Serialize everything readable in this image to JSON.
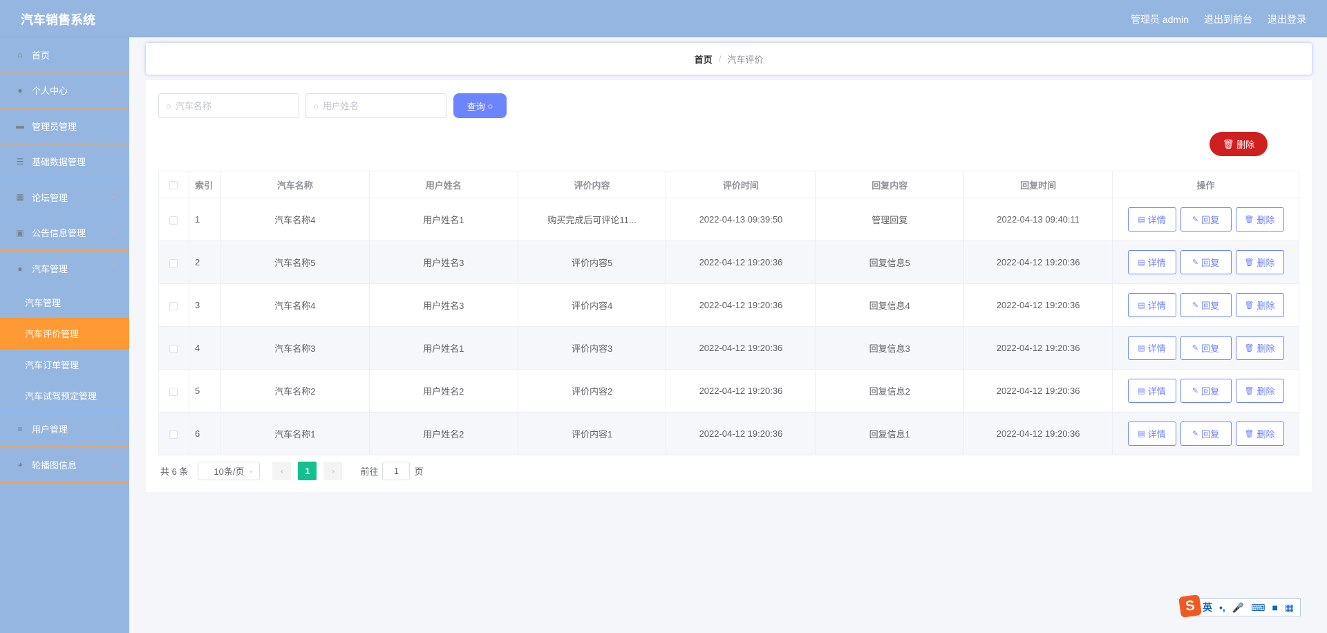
{
  "header": {
    "title": "汽车销售系统",
    "user": "管理员 admin",
    "to_front": "退出到前台",
    "logout": "退出登录"
  },
  "sidebar": {
    "items": [
      {
        "label": "首页",
        "icon": "home-icon"
      },
      {
        "label": "个人中心",
        "icon": "user-icon"
      },
      {
        "label": "管理员管理",
        "icon": "monitor-icon"
      },
      {
        "label": "基础数据管理",
        "icon": "list-icon"
      },
      {
        "label": "论坛管理",
        "icon": "grid-icon"
      },
      {
        "label": "公告信息管理",
        "icon": "clipboard-icon"
      },
      {
        "label": "汽车管理",
        "icon": "user-icon",
        "children": [
          "汽车管理",
          "汽车评价管理",
          "汽车订单管理",
          "汽车试驾预定管理"
        ]
      },
      {
        "label": "用户管理",
        "icon": "sliders-icon"
      },
      {
        "label": "轮播图信息",
        "icon": "gauge-icon"
      }
    ]
  },
  "breadcrumb": {
    "home": "首页",
    "sep": "/",
    "current": "汽车评价"
  },
  "search": {
    "car_placeholder": "汽车名称",
    "user_placeholder": "用户姓名",
    "query": "查询"
  },
  "toolbar": {
    "delete": "删除"
  },
  "table": {
    "headers": [
      "索引",
      "汽车名称",
      "用户姓名",
      "评价内容",
      "评价时间",
      "回复内容",
      "回复时间",
      "操作"
    ],
    "rows": [
      [
        "1",
        "汽车名称4",
        "用户姓名1",
        "购买完成后可评论11...",
        "2022-04-13 09:39:50",
        "管理回复",
        "2022-04-13 09:40:11"
      ],
      [
        "2",
        "汽车名称5",
        "用户姓名3",
        "评价内容5",
        "2022-04-12 19:20:36",
        "回复信息5",
        "2022-04-12 19:20:36"
      ],
      [
        "3",
        "汽车名称4",
        "用户姓名3",
        "评价内容4",
        "2022-04-12 19:20:36",
        "回复信息4",
        "2022-04-12 19:20:36"
      ],
      [
        "4",
        "汽车名称3",
        "用户姓名1",
        "评价内容3",
        "2022-04-12 19:20:36",
        "回复信息3",
        "2022-04-12 19:20:36"
      ],
      [
        "5",
        "汽车名称2",
        "用户姓名2",
        "评价内容2",
        "2022-04-12 19:20:36",
        "回复信息2",
        "2022-04-12 19:20:36"
      ],
      [
        "6",
        "汽车名称1",
        "用户姓名2",
        "评价内容1",
        "2022-04-12 19:20:36",
        "回复信息1",
        "2022-04-12 19:20:36"
      ]
    ],
    "actions": [
      "详情",
      "回复",
      "删除"
    ]
  },
  "pagination": {
    "total": "共 6 条",
    "page_size": "10条/页",
    "current": "1",
    "goto": "前往",
    "goto_value": "1",
    "page_unit": "页"
  },
  "ime": {
    "lang": "英"
  },
  "colors": {
    "header": "#94b6e0",
    "active": "#ff9933",
    "primary": "#6d84ff",
    "danger": "#cf1f1f",
    "page_active": "#13c08e"
  }
}
